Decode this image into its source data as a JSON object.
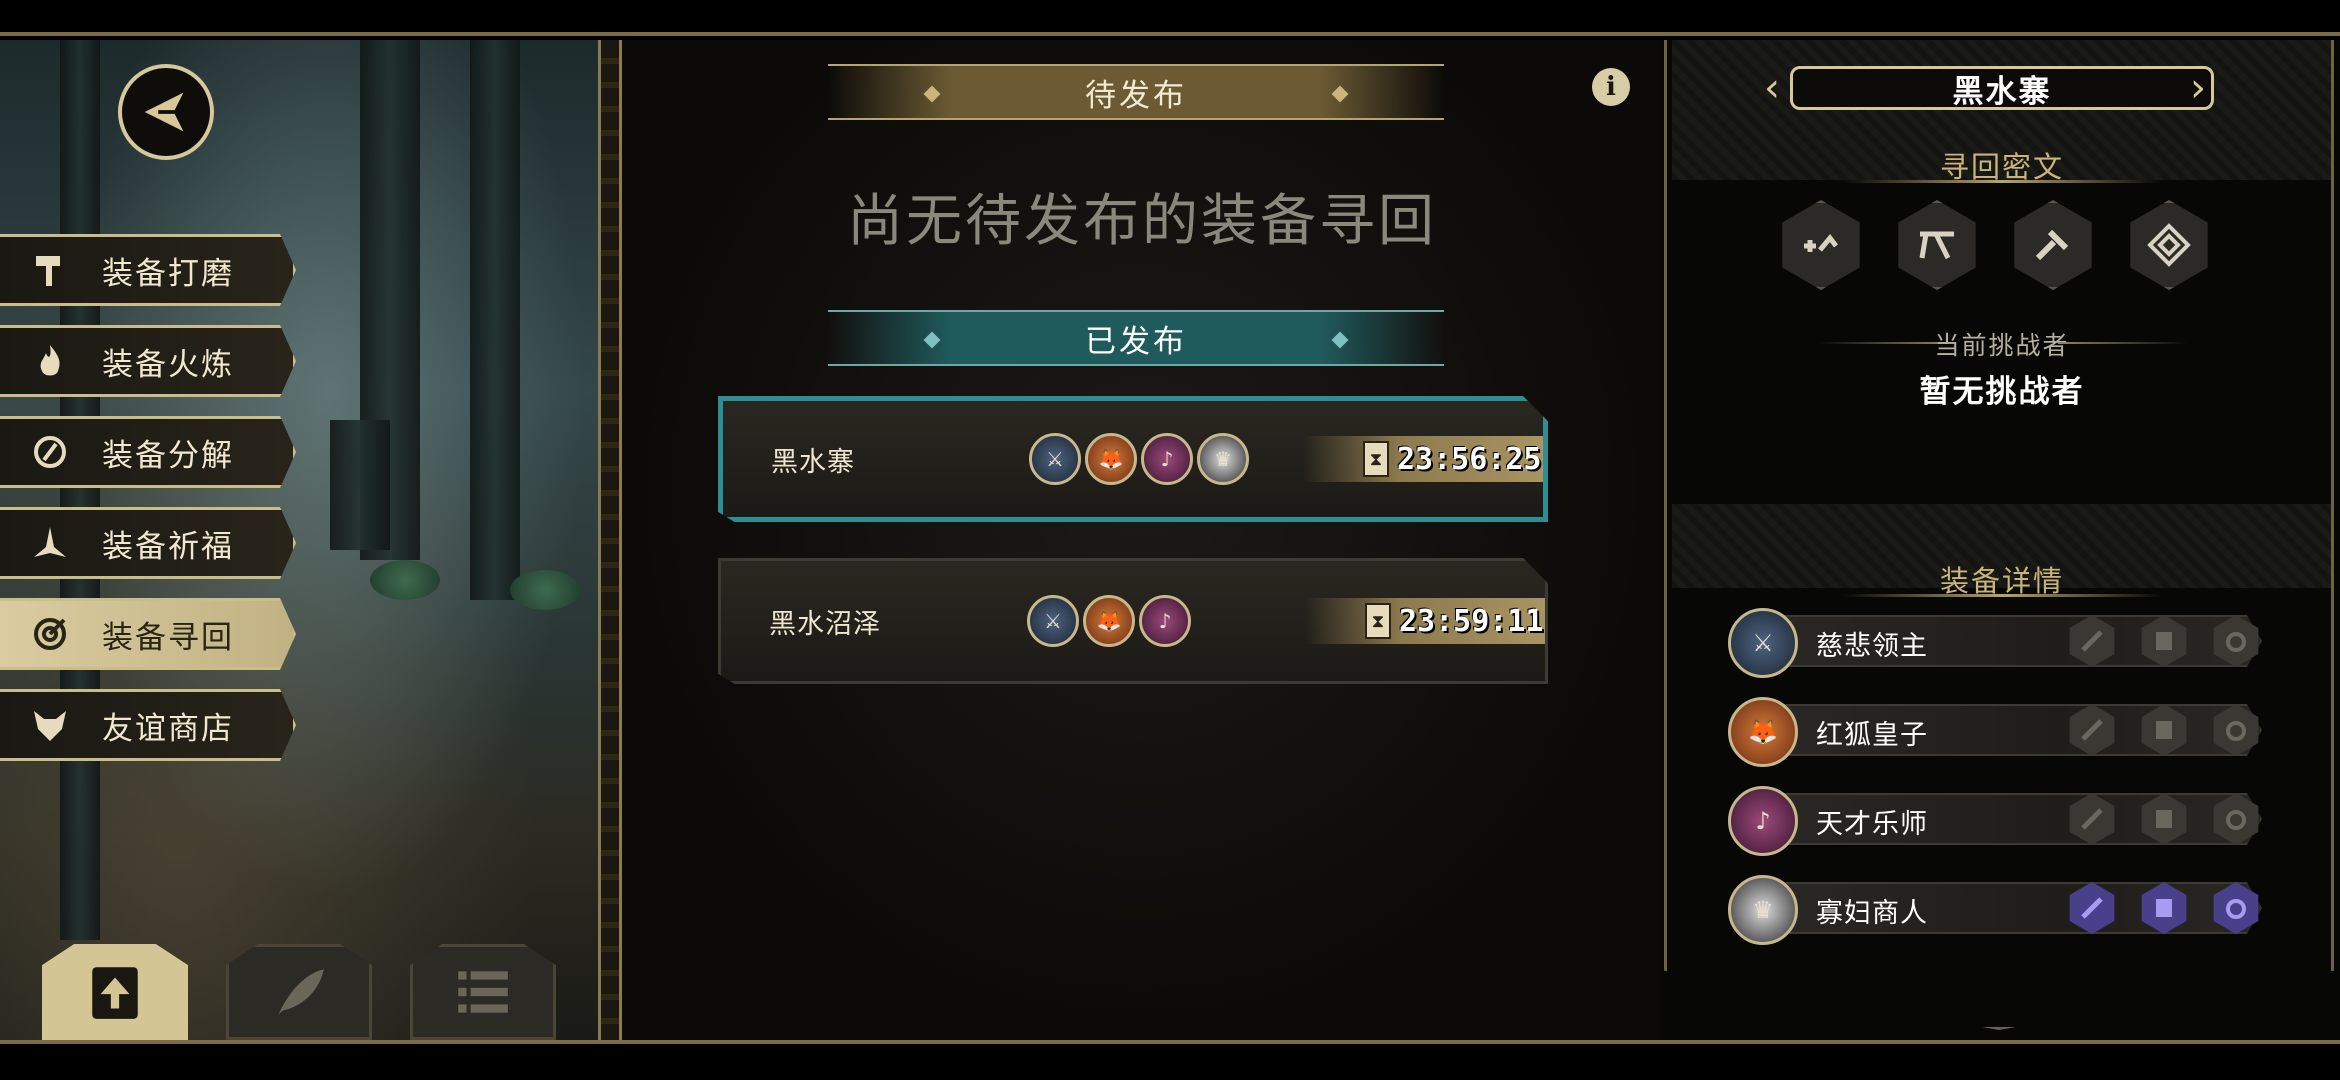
{
  "left_menu": {
    "items": [
      {
        "label": "装备打磨",
        "icon": "hammer-icon",
        "active": false
      },
      {
        "label": "装备火炼",
        "icon": "flame-icon",
        "active": false
      },
      {
        "label": "装备分解",
        "icon": "dismantle-icon",
        "active": false
      },
      {
        "label": "装备祈福",
        "icon": "pray-icon",
        "active": false
      },
      {
        "label": "装备寻回",
        "icon": "target-icon",
        "active": true
      },
      {
        "label": "友谊商店",
        "icon": "fox-head-icon",
        "active": false
      }
    ],
    "bottom_buttons": [
      {
        "icon": "upload-icon",
        "active": true
      },
      {
        "icon": "feather-icon",
        "active": false
      },
      {
        "icon": "list-icon",
        "active": false
      }
    ]
  },
  "center": {
    "pending_title": "待发布",
    "empty_message": "尚无待发布的装备寻回",
    "published_title": "已发布",
    "quests": [
      {
        "name": "黑水寨",
        "avatars": [
          "knight",
          "fox",
          "bard",
          "widow"
        ],
        "timer": "23:56:25",
        "selected": true
      },
      {
        "name": "黑水沼泽",
        "avatars": [
          "knight",
          "fox",
          "bard"
        ],
        "timer": "23:59:11",
        "selected": false
      }
    ]
  },
  "right_panel": {
    "region_name": "黑水寨",
    "cipher_title": "寻回密文",
    "runes": [
      "rune-1-icon",
      "rune-2-icon",
      "rune-3-icon",
      "rune-4-icon"
    ],
    "challenger_label": "当前挑战者",
    "challenger_value": "暂无挑战者",
    "details_title": "装备详情",
    "heroes": [
      {
        "name": "慈悲领主",
        "avatar": "knight",
        "equipment_filled": [
          false,
          false,
          false
        ]
      },
      {
        "name": "红狐皇子",
        "avatar": "fox",
        "equipment_filled": [
          false,
          false,
          false
        ]
      },
      {
        "name": "天才乐师",
        "avatar": "bard",
        "equipment_filled": [
          false,
          false,
          false
        ]
      },
      {
        "name": "寡妇商人",
        "avatar": "widow",
        "equipment_filled": [
          true,
          true,
          true
        ]
      }
    ]
  },
  "colors": {
    "gold": "#d6c898",
    "teal_highlight": "#2f8e92",
    "equipment_filled": "#4a3f8a"
  }
}
